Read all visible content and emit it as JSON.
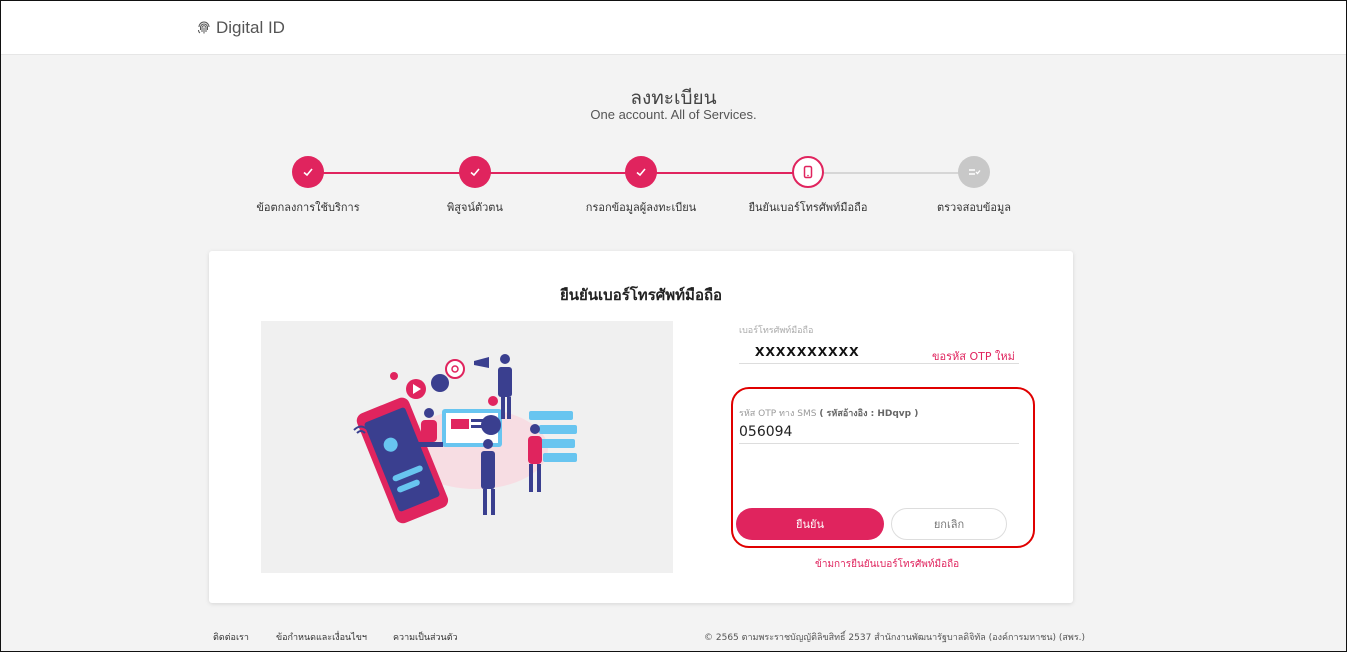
{
  "brand": {
    "name": "Digital ID",
    "icon": "fingerprint-icon"
  },
  "page": {
    "title": "ลงทะเบียน",
    "subtitle": "One account. All of Services."
  },
  "steps": [
    {
      "label": "ข้อตกลงการใช้บริการ",
      "state": "done"
    },
    {
      "label": "พิสูจน์ตัวตน",
      "state": "done"
    },
    {
      "label": "กรอกข้อมูลผู้ลงทะเบียน",
      "state": "done"
    },
    {
      "label": "ยืนยันเบอร์โทรศัพท์มือถือ",
      "state": "current"
    },
    {
      "label": "ตรวจสอบข้อมูล",
      "state": "pending"
    }
  ],
  "colors": {
    "accent": "#e0245e",
    "pending": "#c8c8c8",
    "highlight": "#e00000"
  },
  "card": {
    "title": "ยืนยันเบอร์โทรศัพท์มือถือ",
    "phone_label": "เบอร์โทรศัพท์มือถือ",
    "phone_value": "xxxxxxxxxx",
    "resend_label": "ขอรหัส OTP ใหม่",
    "otp_label": "รหัส OTP ทาง SMS",
    "otp_ref_label": "( รหัสอ้างอิง : HDqvp )",
    "otp_value": "056094",
    "confirm_label": "ยืนยัน",
    "cancel_label": "ยกเลิก",
    "skip_label": "ข้ามการยืนยันเบอร์โทรศัพท์มือถือ"
  },
  "footer": {
    "links": [
      "ติดต่อเรา",
      "ข้อกำหนดและเงื่อนไขฯ",
      "ความเป็นส่วนตัว"
    ],
    "copyright": "© 2565 ตามพระราชบัญญัติลิขสิทธิ์ 2537 สำนักงานพัฒนารัฐบาลดิจิทัล (องค์การมหาชน) (สพร.)"
  }
}
